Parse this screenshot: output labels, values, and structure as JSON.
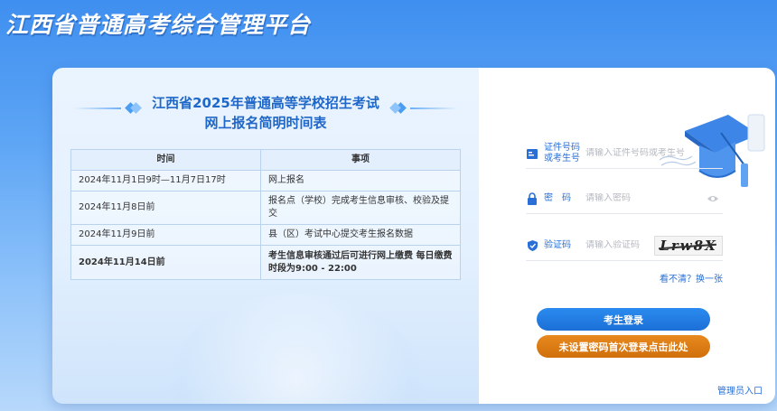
{
  "site": {
    "title": "江西省普通高考综合管理平台"
  },
  "schedule": {
    "title_line1": "江西省2025年普通高等学校招生考试",
    "title_line2": "网上报名简明时间表",
    "headers": {
      "time": "时间",
      "item": "事项"
    },
    "rows": [
      {
        "time": "2024年11月1日9时—11月7日17时",
        "item": "网上报名"
      },
      {
        "time": "2024年11月8日前",
        "item": "报名点（学校）完成考生信息审核、校验及提交"
      },
      {
        "time": "2024年11月9日前",
        "item": "县（区）考试中心提交考生报名数据"
      },
      {
        "time": "2024年11月14日前",
        "item": "考生信息审核通过后可进行网上缴费 每日缴费时段为9:00 - 22:00"
      }
    ]
  },
  "login": {
    "id_label": "证件号码或考生号",
    "id_placeholder": "请输入证件号码或考生号",
    "password_label": "密　码",
    "password_placeholder": "请输入密码",
    "captcha_label": "验证码",
    "captcha_placeholder": "请输入验证码",
    "captcha_text": "Lrw8X",
    "refresh_text": "看不清？换一张",
    "login_button": "考生登录",
    "first_login_button": "未设置密码首次登录点击此处",
    "admin_link": "管理员入口"
  },
  "colors": {
    "primary": "#1b6fd6",
    "accent": "#d06f0b",
    "label": "#2a6fd6"
  }
}
